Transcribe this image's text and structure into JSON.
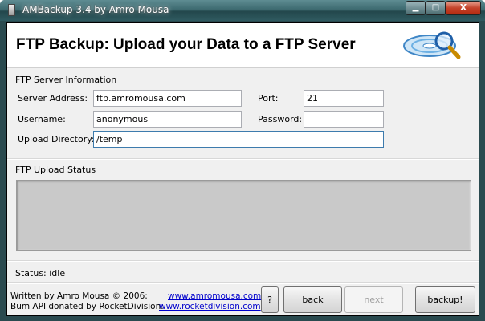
{
  "window": {
    "title": "AMBackup 3.4 by Amro Mousa",
    "controls": {
      "minimize": "▁",
      "maximize": "□",
      "close": "X"
    }
  },
  "header": {
    "title": "FTP Backup: Upload your Data to a FTP Server",
    "logo_icon": "magnifier-disc-icon"
  },
  "server_info": {
    "section_label": "FTP Server Information",
    "server_address": {
      "label": "Server Address:",
      "value": "ftp.amromousa.com"
    },
    "port": {
      "label": "Port:",
      "value": "21"
    },
    "username": {
      "label": "Username:",
      "value": "anonymous"
    },
    "password": {
      "label": "Password:",
      "value": ""
    },
    "upload_directory": {
      "label": "Upload Directory:",
      "value": "/temp"
    }
  },
  "upload_status": {
    "section_label": "FTP Upload Status",
    "status_text": "Status: idle"
  },
  "footer": {
    "credit_line1": "Written by Amro Mousa © 2006:",
    "credit_line2": "Bum API donated by RocketDivision:",
    "link1": "www.amromousa.com",
    "link2": "www.rocketdivision.com"
  },
  "buttons": {
    "help": "?",
    "back": "back",
    "next": "next",
    "backup": "backup!"
  },
  "colors": {
    "titlebar": "#3d6a70",
    "link": "#0000cc",
    "status_box": "#c9c9c9"
  }
}
